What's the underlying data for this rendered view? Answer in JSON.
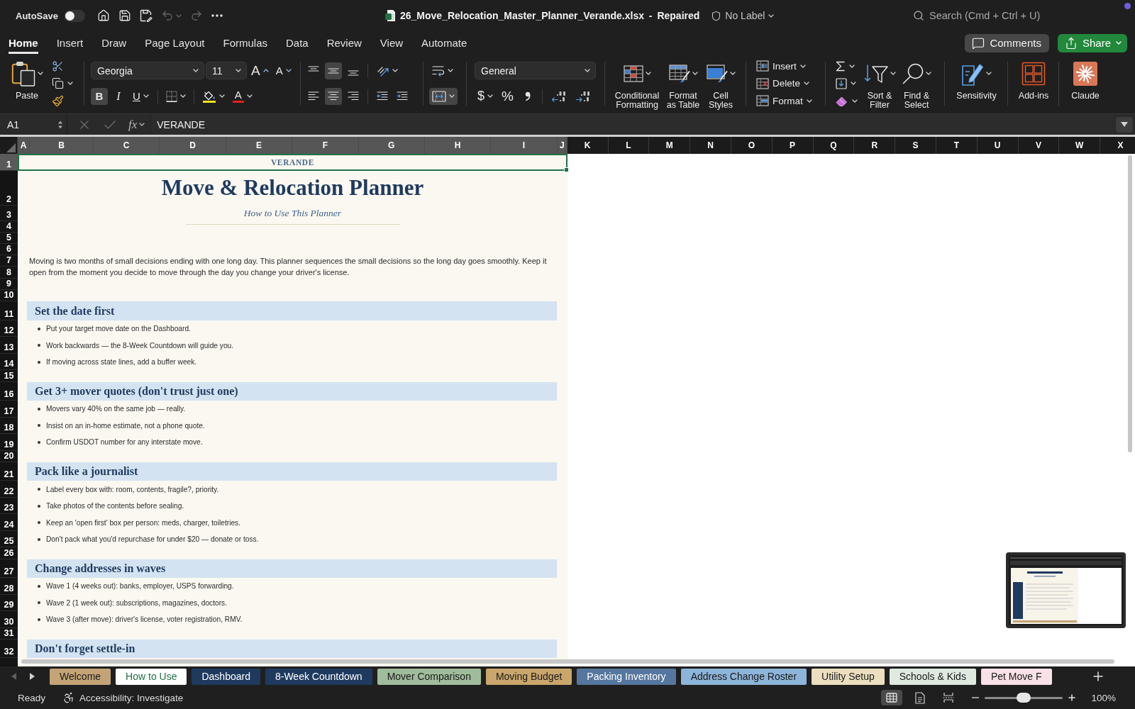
{
  "title_bar": {
    "autosave": {
      "label": "AutoSave",
      "on": false
    },
    "undo": {
      "disabled": true
    },
    "redo": {
      "disabled": true
    },
    "document_title": "26_Move_Relocation_Master_Planner_Verande.xlsx - Repaired",
    "sensitivity_label": "No Label",
    "search": {
      "placeholder": "Search (Cmd + Ctrl + U)"
    }
  },
  "ribbon": {
    "tabs": [
      {
        "label": "Home",
        "selected": true
      },
      {
        "label": "Insert",
        "selected": false
      },
      {
        "label": "Draw",
        "selected": false
      },
      {
        "label": "Page Layout",
        "selected": false
      },
      {
        "label": "Formulas",
        "selected": false
      },
      {
        "label": "Data",
        "selected": false
      },
      {
        "label": "Review",
        "selected": false
      },
      {
        "label": "View",
        "selected": false
      },
      {
        "label": "Automate",
        "selected": false
      }
    ],
    "comments_button": "Comments",
    "share_button": "Share",
    "paste": "Paste",
    "font_name": "Georgia",
    "font_size": "11",
    "grow_font": "A",
    "shrink_font": "A",
    "font_styles": [
      {
        "kind": "bold",
        "label": "B",
        "on": true
      },
      {
        "kind": "italic",
        "label": "I",
        "on": false
      },
      {
        "kind": "underline",
        "label": "U",
        "on": false
      }
    ],
    "font_color": "A",
    "vertical_align": [
      {
        "kind": "top",
        "on": false
      },
      {
        "kind": "middle",
        "on": true
      },
      {
        "kind": "bottom",
        "on": false
      }
    ],
    "horizontal_align": [
      {
        "kind": "left",
        "on": false
      },
      {
        "kind": "center",
        "on": true
      },
      {
        "kind": "right",
        "on": false
      }
    ],
    "wrap_text": {
      "on": false
    },
    "merge_center": {
      "on": true
    },
    "number_format": "General",
    "currency": "$",
    "percent": "%",
    "styles": [
      {
        "kind": "conditional",
        "label": "Conditional Formatting"
      },
      {
        "kind": "table",
        "label": "Format as Table"
      },
      {
        "kind": "cell",
        "label": "Cell Styles"
      }
    ],
    "cells": [
      {
        "kind": "insert",
        "label": "Insert"
      },
      {
        "kind": "delete",
        "label": "Delete"
      },
      {
        "kind": "format",
        "label": "Format"
      }
    ],
    "editing": [
      {
        "kind": "sort",
        "label": "Sort & Filter"
      },
      {
        "kind": "find",
        "label": "Find & Select"
      }
    ],
    "extras": [
      {
        "kind": "sensitivity",
        "label": "Sensitivity"
      },
      {
        "kind": "addins",
        "label": "Add-ins"
      },
      {
        "kind": "claude",
        "label": "Claude"
      }
    ]
  },
  "formula_bar": {
    "name_box": "A1",
    "function_label": "fx",
    "formula": "VERANDE"
  },
  "sheet": {
    "columns": [
      {
        "label": "A",
        "selected": true
      },
      {
        "label": "B",
        "selected": true
      },
      {
        "label": "C",
        "selected": true
      },
      {
        "label": "D",
        "selected": true
      },
      {
        "label": "E",
        "selected": true
      },
      {
        "label": "F",
        "selected": true
      },
      {
        "label": "G",
        "selected": true
      },
      {
        "label": "H",
        "selected": true
      },
      {
        "label": "I",
        "selected": true
      },
      {
        "label": "J",
        "selected": true
      },
      {
        "label": "K",
        "selected": false
      },
      {
        "label": "L",
        "selected": false
      },
      {
        "label": "M",
        "selected": false
      },
      {
        "label": "N",
        "selected": false
      },
      {
        "label": "O",
        "selected": false
      },
      {
        "label": "P",
        "selected": false
      },
      {
        "label": "Q",
        "selected": false
      },
      {
        "label": "R",
        "selected": false
      },
      {
        "label": "S",
        "selected": false
      },
      {
        "label": "T",
        "selected": false
      },
      {
        "label": "U",
        "selected": false
      },
      {
        "label": "V",
        "selected": false
      },
      {
        "label": "W",
        "selected": false
      },
      {
        "label": "X",
        "selected": false
      }
    ],
    "rows": [
      {
        "label": "1",
        "selected": true
      },
      {
        "label": "2",
        "selected": false
      },
      {
        "label": "3",
        "selected": false
      },
      {
        "label": "4",
        "selected": false
      },
      {
        "label": "5",
        "selected": false
      },
      {
        "label": "6",
        "selected": false
      },
      {
        "label": "7",
        "selected": false
      },
      {
        "label": "8",
        "selected": false
      },
      {
        "label": "9",
        "selected": false
      },
      {
        "label": "10",
        "selected": false
      },
      {
        "label": "11",
        "selected": false
      },
      {
        "label": "12",
        "selected": false
      },
      {
        "label": "13",
        "selected": false
      },
      {
        "label": "14",
        "selected": false
      },
      {
        "label": "15",
        "selected": false
      },
      {
        "label": "16",
        "selected": false
      },
      {
        "label": "17",
        "selected": false
      },
      {
        "label": "18",
        "selected": false
      },
      {
        "label": "19",
        "selected": false
      },
      {
        "label": "20",
        "selected": false
      },
      {
        "label": "21",
        "selected": false
      },
      {
        "label": "22",
        "selected": false
      },
      {
        "label": "23",
        "selected": false
      },
      {
        "label": "24",
        "selected": false
      },
      {
        "label": "25",
        "selected": false
      },
      {
        "label": "26",
        "selected": false
      },
      {
        "label": "27",
        "selected": false
      },
      {
        "label": "28",
        "selected": false
      },
      {
        "label": "29",
        "selected": false
      },
      {
        "label": "30",
        "selected": false
      },
      {
        "label": "31",
        "selected": false
      },
      {
        "label": "32",
        "selected": false
      }
    ],
    "brand": "VERANDE",
    "title": "Move & Relocation Planner",
    "subtitle": "How to Use This Planner",
    "intro": "Moving is two months of small decisions ending with one long day. This planner sequences the small decisions so the long day goes smoothly. Keep it open from the moment you decide to move through the day you change your driver's license.",
    "sections": [
      {
        "heading": "Set the date first",
        "bullets": [
          "Put your target move date on the Dashboard.",
          "Work backwards — the 8-Week Countdown will guide you.",
          "If moving across state lines, add a buffer week."
        ]
      },
      {
        "heading": "Get 3+ mover quotes (don't trust just one)",
        "bullets": [
          "Movers vary 40% on the same job — really.",
          "Insist on an in-home estimate, not a phone quote.",
          "Confirm USDOT number for any interstate move."
        ]
      },
      {
        "heading": "Pack like a journalist",
        "bullets": [
          "Label every box with: room, contents, fragile?, priority.",
          "Take photos of the contents before sealing.",
          "Keep an 'open first' box per person: meds, charger, toiletries.",
          "Don't pack what you'd repurchase for under $20 — donate or toss."
        ]
      },
      {
        "heading": "Change addresses in waves",
        "bullets": [
          "Wave 1 (4 weeks out): banks, employer, USPS forwarding.",
          "Wave 2 (1 week out): subscriptions, magazines, doctors.",
          "Wave 3 (after move): driver's license, voter registration, RMV."
        ]
      },
      {
        "heading": "Don't forget settle-in"
      }
    ]
  },
  "sheet_tabs": [
    {
      "label": "Welcome",
      "selected": false,
      "color": "#c4a476"
    },
    {
      "label": "How to Use",
      "selected": true
    },
    {
      "label": "Dashboard",
      "selected": false,
      "color": "#1f3a5f"
    },
    {
      "label": "8-Week Countdown",
      "selected": false,
      "color": "#1f3a5f"
    },
    {
      "label": "Mover Comparison",
      "selected": false,
      "color": "#a0bc9c"
    },
    {
      "label": "Moving Budget",
      "selected": false,
      "color": "#c9a66b"
    },
    {
      "label": "Packing Inventory",
      "selected": false,
      "color": "#55769e"
    },
    {
      "label": "Address Change Roster",
      "selected": false,
      "color": "#8db4d9"
    },
    {
      "label": "Utility Setup",
      "selected": false,
      "color": "#ecdfc0"
    },
    {
      "label": "Schools & Kids",
      "selected": false,
      "color": "#dfe9e0"
    },
    {
      "label": "Pet Move F",
      "selected": false,
      "color": "#f8e1e7"
    }
  ],
  "status_bar": {
    "status": "Ready",
    "accessibility": "Accessibility: Investigate",
    "views": [
      {
        "kind": "normal",
        "selected": true
      },
      {
        "kind": "page_layout",
        "selected": false
      },
      {
        "kind": "page_break",
        "selected": false
      }
    ],
    "zoom": {
      "level": 0.5,
      "reading": "100%"
    }
  }
}
